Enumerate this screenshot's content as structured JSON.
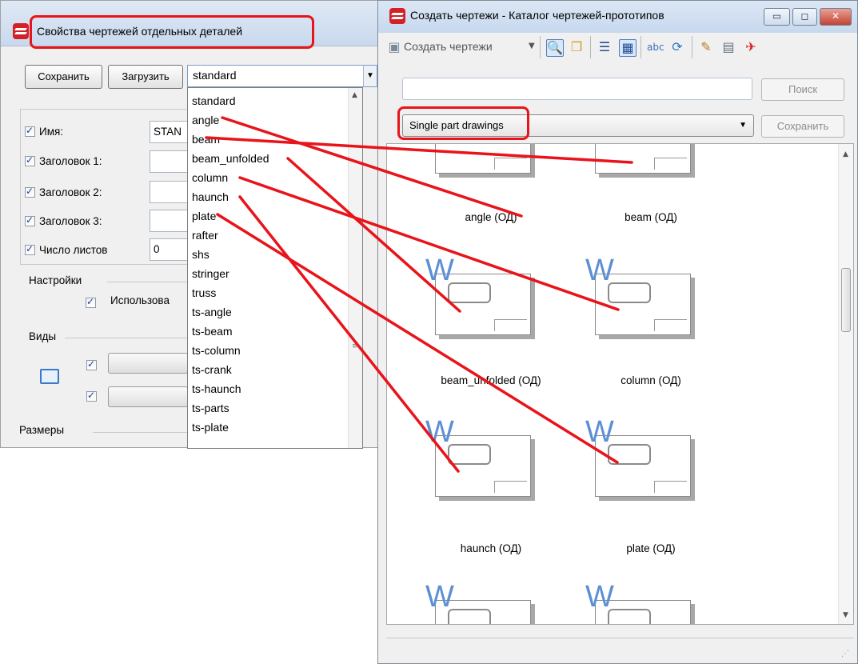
{
  "left_window": {
    "title": "Свойства чертежей отдельных деталей",
    "save_button": "Сохранить",
    "load_button": "Загрузить",
    "settings_combo": "standard",
    "fields": [
      {
        "label": "Имя:",
        "value": "STAN",
        "checked": true
      },
      {
        "label": "Заголовок 1:",
        "value": "",
        "checked": true
      },
      {
        "label": "Заголовок 2:",
        "value": "",
        "checked": true
      },
      {
        "label": "Заголовок 3:",
        "value": "",
        "checked": true
      },
      {
        "label": "Число листов",
        "value": "0",
        "checked": true
      }
    ],
    "settings_section": "Настройки",
    "use_option": "Использова",
    "views_section": "Виды",
    "dimensions_section": "Размеры",
    "dropdown_options": [
      "standard",
      "angle",
      "beam",
      "beam_unfolded",
      "column",
      "haunch",
      "plate",
      "rafter",
      "shs",
      "stringer",
      "truss",
      "ts-angle",
      "ts-beam",
      "ts-column",
      "ts-crank",
      "ts-haunch",
      "ts-parts",
      "ts-plate"
    ]
  },
  "right_window": {
    "title": "Создать чертежи - Каталог чертежей-прототипов",
    "create_drawings": "Создать чертежи",
    "search_button": "Поиск",
    "search_value": "",
    "catalog_selected": "Single part drawings",
    "save_button": "Сохранить",
    "thumbnails": [
      {
        "label": "angle (ОД)"
      },
      {
        "label": "beam (ОД)"
      },
      {
        "label": "beam_unfolded (ОД)"
      },
      {
        "label": "column (ОД)"
      },
      {
        "label": "haunch (ОД)"
      },
      {
        "label": "plate (ОД)"
      },
      {
        "label": ""
      },
      {
        "label": ""
      }
    ],
    "thumbnail_badge": "W"
  },
  "colors": {
    "highlight": "#e8141a",
    "accent_w": "#5c8fd4"
  }
}
